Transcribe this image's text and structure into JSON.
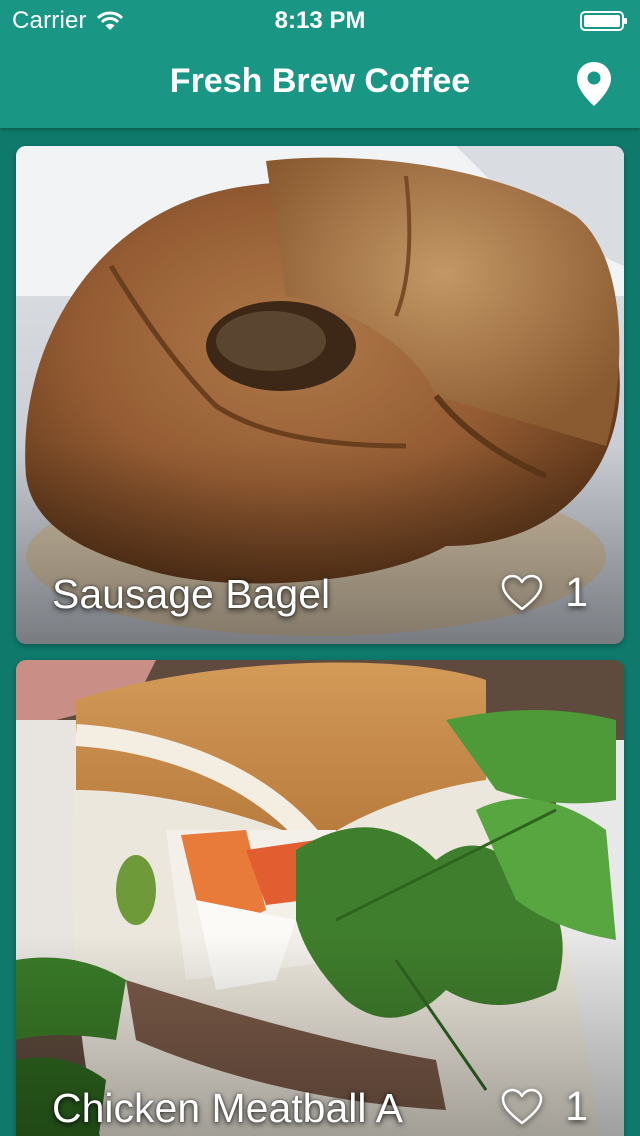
{
  "status_bar": {
    "carrier": "Carrier",
    "time": "8:13 PM",
    "wifi_icon": "wifi-icon",
    "battery_icon": "battery-icon"
  },
  "nav": {
    "title": "Fresh Brew Coffee",
    "location_icon": "map-pin-icon"
  },
  "colors": {
    "header_bg": "#1a9684",
    "page_bg": "#0f7a6c",
    "text": "#ffffff"
  },
  "feed": {
    "items": [
      {
        "title": "Sausage Bagel",
        "likes": "1",
        "like_icon": "heart-outline-icon"
      },
      {
        "title": "Chicken Meatball A",
        "likes": "1",
        "like_icon": "heart-outline-icon"
      }
    ]
  }
}
